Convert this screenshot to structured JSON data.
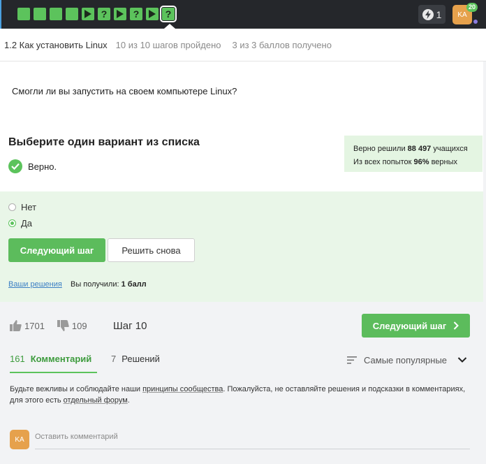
{
  "topbar": {
    "steps": [
      {
        "type": "done"
      },
      {
        "type": "done"
      },
      {
        "type": "done"
      },
      {
        "type": "done"
      },
      {
        "type": "play"
      },
      {
        "type": "quiz",
        "glyph": "?"
      },
      {
        "type": "play"
      },
      {
        "type": "quiz",
        "glyph": "?"
      },
      {
        "type": "play"
      },
      {
        "type": "quiz",
        "glyph": "?",
        "current": true
      }
    ],
    "energy": "1",
    "user_initials": "KA",
    "notifications": "20"
  },
  "lesson": {
    "title": "1.2 Как установить Linux",
    "steps_done": "10 из 10 шагов пройдено",
    "points": "3 из 3 баллов  получено"
  },
  "question": "Смогли ли вы запустить на своем компьютере Linux?",
  "quiz": {
    "instruction": "Выберите один вариант из списка",
    "verdict": "Верно.",
    "stats": {
      "solved_prefix": "Верно решили ",
      "solved_count": "88 497",
      "solved_suffix": " учащихся",
      "attempts_prefix": "Из всех попыток ",
      "attempts_percent": "96%",
      "attempts_suffix": " верных"
    },
    "options": [
      {
        "label": "Нет",
        "checked": false
      },
      {
        "label": "Да",
        "checked": true
      }
    ],
    "next_button": "Следующий шаг",
    "retry_button": "Решить снова",
    "your_solutions": "Ваши решения",
    "got_prefix": "Вы получили: ",
    "got_value": "1 балл"
  },
  "footer": {
    "likes": "1701",
    "dislikes": "109",
    "step_label": "Шаг 10",
    "next_button": "Следующий шаг"
  },
  "discussion": {
    "comments_count": "161",
    "comments_label": "Комментарий",
    "solutions_count": "7",
    "solutions_label": "Решений",
    "sort_label": "Самые популярные",
    "rules_1": "Будьте вежливы и соблюдайте наши ",
    "rules_link_1": "принципы сообщества",
    "rules_2": ". Пожалуйста, не оставляйте решения и подсказки в комментариях, для этого есть ",
    "rules_link_2": "отдельный форум",
    "rules_3": ".",
    "comment_placeholder": "Оставить комментарий"
  },
  "colors": {
    "accent_green": "#5cc35c",
    "topbar_bg": "#25272b",
    "link_blue": "#3b7fc4"
  }
}
